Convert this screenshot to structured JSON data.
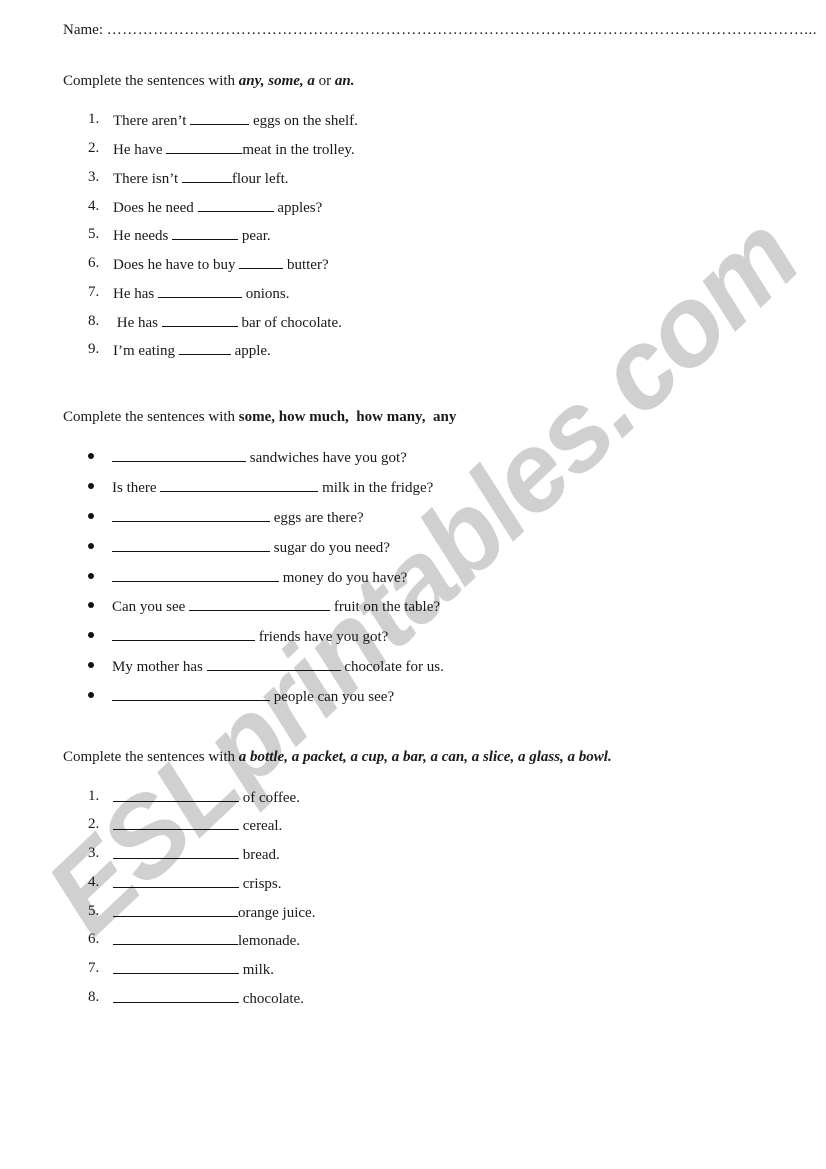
{
  "header": {
    "name_label": "Name:",
    "name_dots": "………………………………………………………………………………………………………………………..."
  },
  "watermark": {
    "text": "ESLprintables.com",
    "color": "#d0d0d0"
  },
  "section1": {
    "instruction_prefix": "Complete the sentences with ",
    "instruction_words": "any, some, a",
    "instruction_or": " or ",
    "instruction_last": "an.",
    "items": [
      {
        "num": "1.",
        "before": "There aren’t ",
        "after": " eggs on the shelf."
      },
      {
        "num": "2.",
        "before": "He have ",
        "after": "meat in the trolley."
      },
      {
        "num": "3.",
        "before": "There isn’t ",
        "after": "flour left."
      },
      {
        "num": "4.",
        "before": "Does he need ",
        "after": " apples?"
      },
      {
        "num": "5.",
        "before": "He needs ",
        "after": " pear."
      },
      {
        "num": "6.",
        "before": "Does he have to buy ",
        "after": " butter?"
      },
      {
        "num": "7.",
        "before": "He has ",
        "after": " onions."
      },
      {
        "num": "8.",
        "before": " He has ",
        "after": " bar of chocolate."
      },
      {
        "num": "9.",
        "before": "I’m eating ",
        "after": " apple."
      }
    ]
  },
  "section2": {
    "instruction_prefix": "Complete the sentences with ",
    "instruction_words": "some, how much,  how many,  any",
    "items": [
      {
        "before": "",
        "after": " sandwiches have you got?"
      },
      {
        "before": "Is there ",
        "after": " milk in the fridge?"
      },
      {
        "before": "",
        "after": " eggs are there?"
      },
      {
        "before": "",
        "after": " sugar do you need?"
      },
      {
        "before": "",
        "after": " money do you have?"
      },
      {
        "before": "Can you see ",
        "after": " fruit on the table?"
      },
      {
        "before": "",
        "after": " friends have you got?"
      },
      {
        "before": "My mother has ",
        "after": " chocolate for us."
      },
      {
        "before": "",
        "after": " people can you see?"
      }
    ]
  },
  "section3": {
    "instruction_prefix": "Complete the sentences with ",
    "instruction_words": "a bottle, a packet, a cup, a bar, a can, a slice, a glass, a bowl.",
    "items": [
      {
        "num": "1.",
        "after": " of coffee."
      },
      {
        "num": "2.",
        "after": " cereal."
      },
      {
        "num": "3.",
        "after": " bread."
      },
      {
        "num": "4.",
        "after": " crisps."
      },
      {
        "num": "5.",
        "after": "orange juice."
      },
      {
        "num": "6.",
        "after": "lemonade."
      },
      {
        "num": "7.",
        "after": " milk."
      },
      {
        "num": "8.",
        "after": " chocolate."
      }
    ]
  }
}
